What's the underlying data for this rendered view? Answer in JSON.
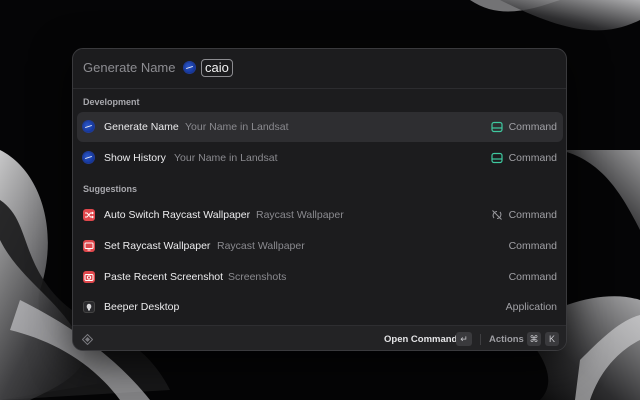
{
  "search": {
    "command_title": "Generate Name",
    "query": "caio"
  },
  "sections": [
    {
      "header": "Development",
      "items": [
        {
          "title": "Generate Name",
          "subtitle": "Your Name in Landsat",
          "accessory": "Command",
          "icon": "nasa-logo-icon",
          "accessory_icon": "hard-drive-icon",
          "selected": true
        },
        {
          "title": "Show History",
          "subtitle": "Your Name in Landsat",
          "accessory": "Command",
          "icon": "nasa-logo-icon",
          "accessory_icon": "hard-drive-icon",
          "selected": false
        }
      ]
    },
    {
      "header": "Suggestions",
      "items": [
        {
          "title": "Auto Switch Raycast Wallpaper",
          "subtitle": "Raycast Wallpaper",
          "accessory": "Command",
          "icon": "shuffle-icon",
          "accessory_icon": "no-sync-icon"
        },
        {
          "title": "Set Raycast Wallpaper",
          "subtitle": "Raycast Wallpaper",
          "accessory": "Command",
          "icon": "wallpaper-icon"
        },
        {
          "title": "Paste Recent Screenshot",
          "subtitle": "Screenshots",
          "accessory": "Command",
          "icon": "camera-icon"
        },
        {
          "title": "Beeper Desktop",
          "subtitle": "",
          "accessory": "Application",
          "icon": "beeper-icon"
        }
      ]
    }
  ],
  "action_bar": {
    "primary_action": "Open Command",
    "primary_shortcut": "↵",
    "actions_label": "Actions",
    "actions_shortcut_modifier": "⌘",
    "actions_shortcut_key": "K"
  },
  "colors": {
    "window_bg": "#1c1c1e",
    "selected_row": "#2e2e31",
    "icon_red": "#e0474c",
    "drive_icon_green": "#3fc9a0"
  }
}
